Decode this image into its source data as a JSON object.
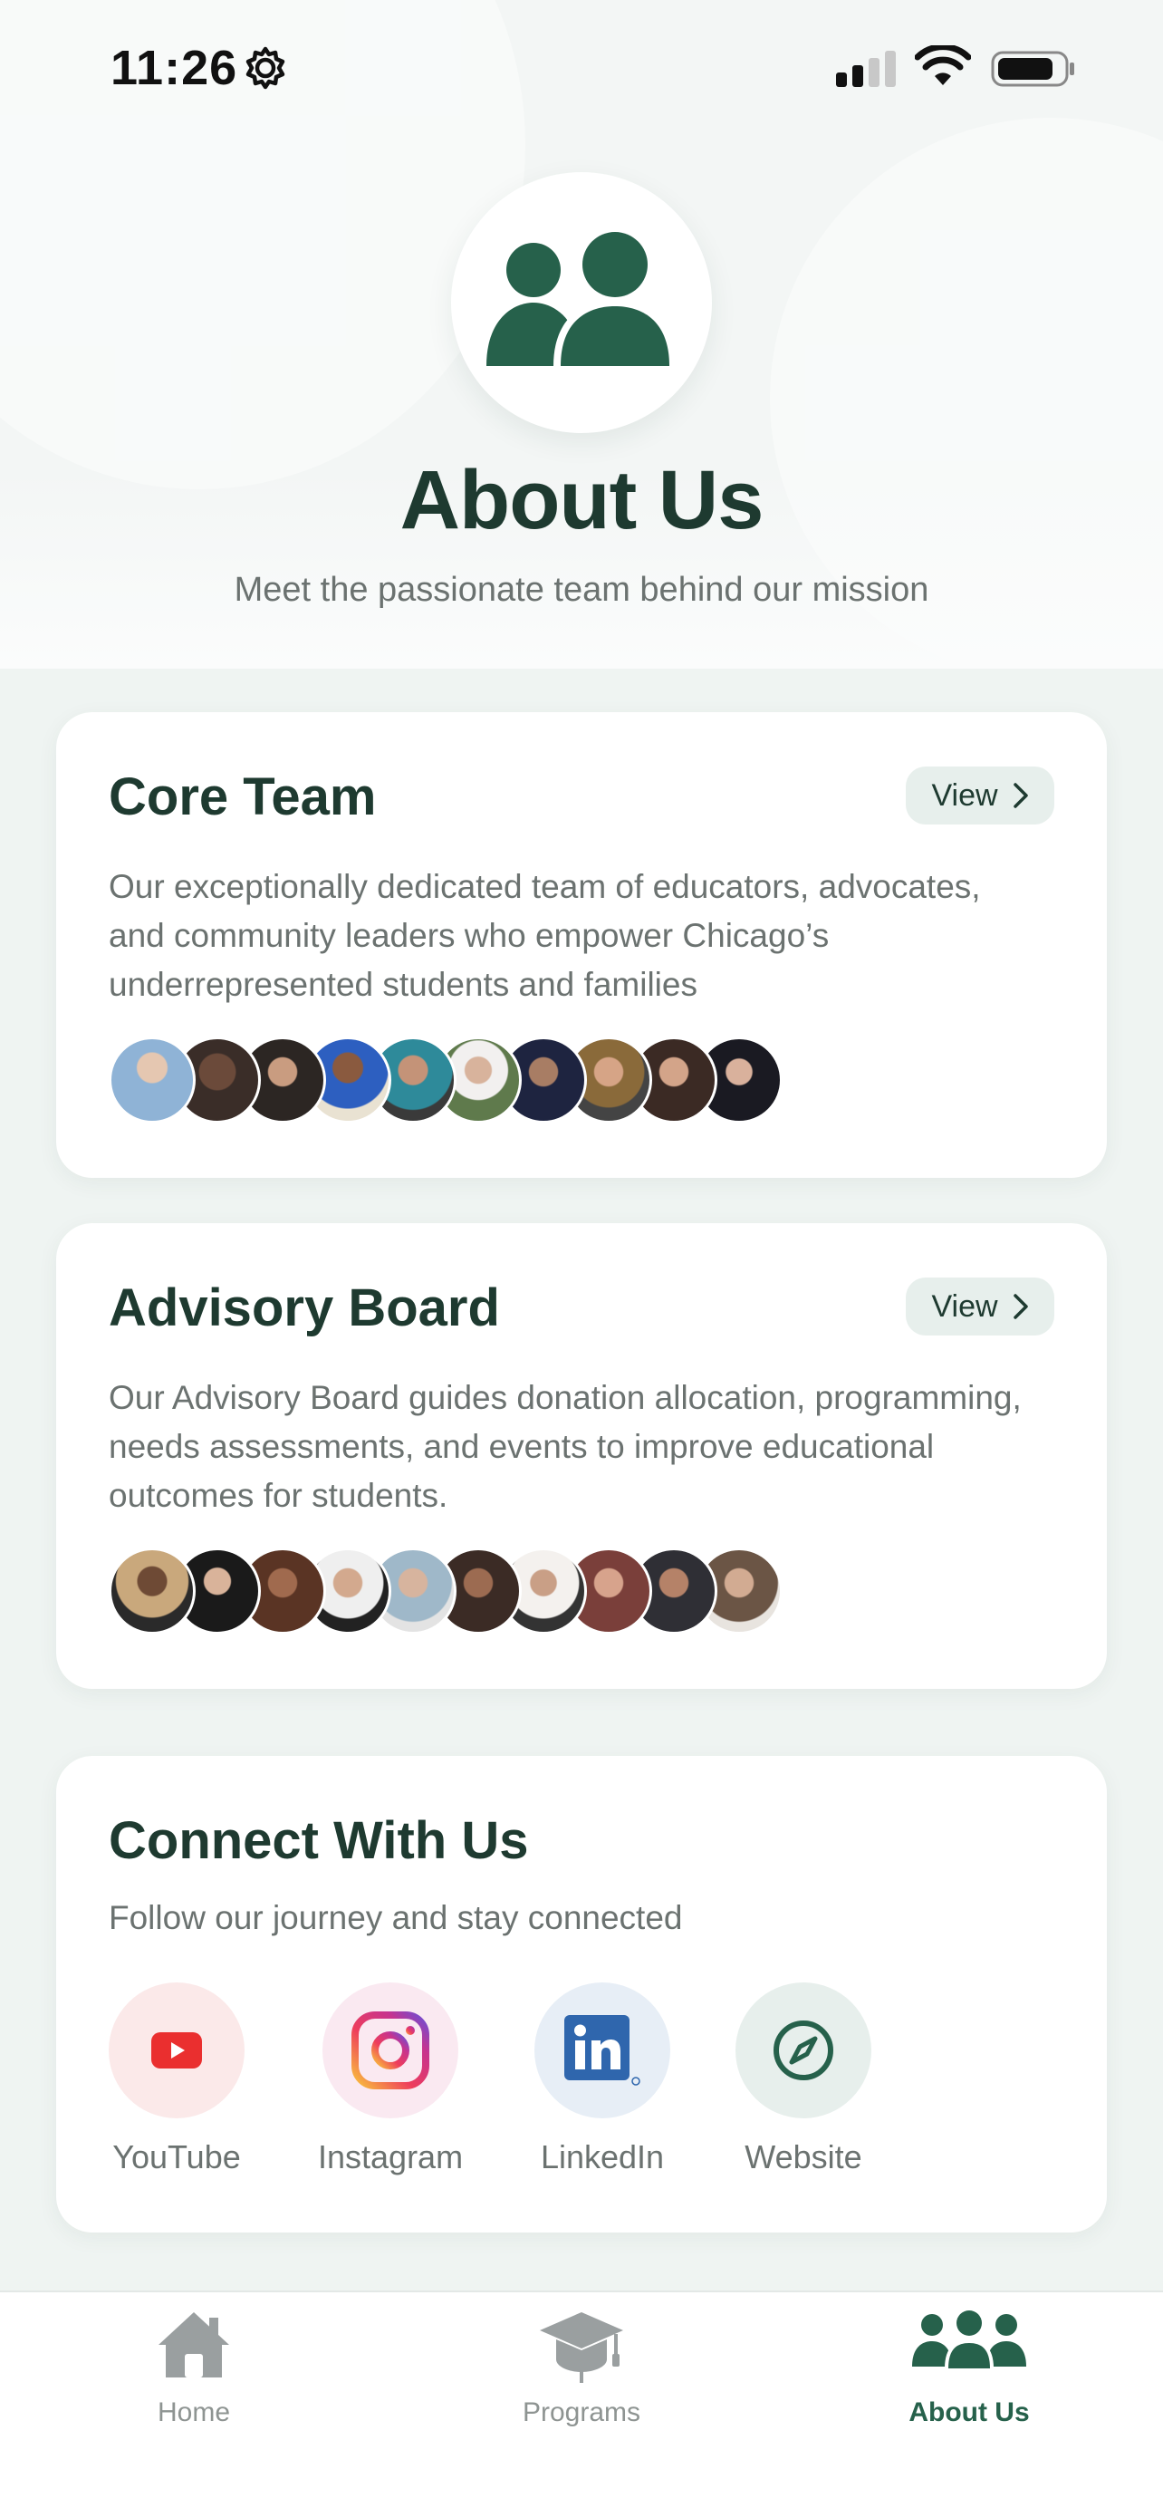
{
  "status_bar": {
    "time": "11:26"
  },
  "hero": {
    "title": "About Us",
    "subtitle": "Meet the passionate team behind our mission"
  },
  "cards": {
    "core_team": {
      "title": "Core Team",
      "view_label": "View",
      "description": "Our exceptionally dedicated team of educators, advocates, and community leaders who empower Chicago’s underrepresented students and families",
      "avatar_count": 10
    },
    "advisory_board": {
      "title": "Advisory Board",
      "view_label": "View",
      "description": "Our Advisory Board guides donation allocation, programming, needs assessments, and events to improve educational outcomes for students.",
      "avatar_count": 10
    }
  },
  "connect": {
    "title": "Connect With Us",
    "subtitle": "Follow our journey and stay connected",
    "links": [
      {
        "label": "YouTube",
        "icon": "youtube-icon"
      },
      {
        "label": "Instagram",
        "icon": "instagram-icon"
      },
      {
        "label": "LinkedIn",
        "icon": "linkedin-icon"
      },
      {
        "label": "Website",
        "icon": "compass-icon"
      }
    ]
  },
  "tabbar": {
    "tabs": [
      {
        "label": "Home",
        "icon": "home-icon",
        "active": false
      },
      {
        "label": "Programs",
        "icon": "graduation-cap-icon",
        "active": false
      },
      {
        "label": "About Us",
        "icon": "people-icon",
        "active": true
      }
    ]
  },
  "colors": {
    "accent": "#26614b",
    "title": "#1e3a30",
    "muted": "#6b7270",
    "background": "#eff4f2"
  }
}
